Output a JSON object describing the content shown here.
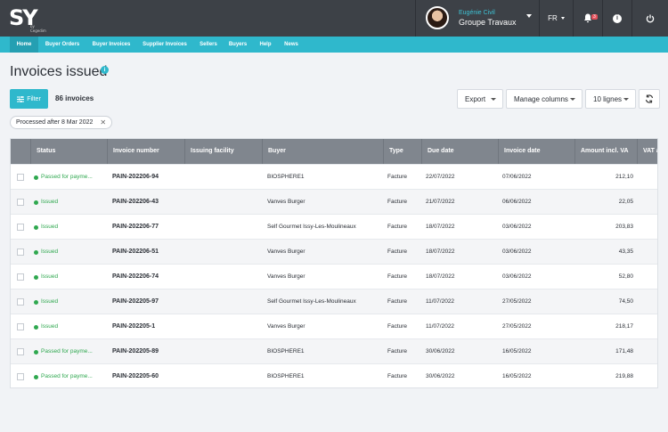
{
  "app": {
    "logo": "SY",
    "logo_sub": "by Cegedim"
  },
  "user": {
    "name": "Eugénie Civil",
    "company": "Groupe Travaux"
  },
  "header": {
    "language": "FR",
    "notifications_count": "3"
  },
  "nav": [
    "Home",
    "Buyer Orders",
    "Buyer Invoices",
    "Supplier Invoices",
    "Sellers",
    "Buyers",
    "Help",
    "News"
  ],
  "page": {
    "title": "Invoices issued",
    "filter_label": "Filter",
    "count": "86 invoices"
  },
  "toolbar": {
    "export": "Export",
    "manage_columns": "Manage columns",
    "rows": "10 lignes"
  },
  "filters": {
    "chip": "Processed after 8 Mar 2022"
  },
  "table": {
    "columns": [
      "Status",
      "Invoice number",
      "Issuing facility",
      "Buyer",
      "Type",
      "Due date",
      "Invoice date",
      "Amount incl. VA",
      "VAT a"
    ],
    "rows": [
      {
        "status": "Passed for payme...",
        "number": "PAIN-202206-94",
        "facility": "",
        "buyer": "BIOSPHERE1",
        "type": "Facture",
        "due": "22/07/2022",
        "date": "07/06/2022",
        "amount": "212,10"
      },
      {
        "status": "Issued",
        "number": "PAIN-202206-43",
        "facility": "",
        "buyer": "Vanves Burger",
        "type": "Facture",
        "due": "21/07/2022",
        "date": "06/06/2022",
        "amount": "22,05"
      },
      {
        "status": "Issued",
        "number": "PAIN-202206-77",
        "facility": "",
        "buyer": "Self Gourmet Issy-Les-Moulineaux",
        "type": "Facture",
        "due": "18/07/2022",
        "date": "03/06/2022",
        "amount": "203,83"
      },
      {
        "status": "Issued",
        "number": "PAIN-202206-51",
        "facility": "",
        "buyer": "Vanves Burger",
        "type": "Facture",
        "due": "18/07/2022",
        "date": "03/06/2022",
        "amount": "43,35"
      },
      {
        "status": "Issued",
        "number": "PAIN-202206-74",
        "facility": "",
        "buyer": "Vanves Burger",
        "type": "Facture",
        "due": "18/07/2022",
        "date": "03/06/2022",
        "amount": "52,80"
      },
      {
        "status": "Issued",
        "number": "PAIN-202205-97",
        "facility": "",
        "buyer": "Self Gourmet Issy-Les-Moulineaux",
        "type": "Facture",
        "due": "11/07/2022",
        "date": "27/05/2022",
        "amount": "74,50"
      },
      {
        "status": "Issued",
        "number": "PAIN-202205-1",
        "facility": "",
        "buyer": "Vanves Burger",
        "type": "Facture",
        "due": "11/07/2022",
        "date": "27/05/2022",
        "amount": "218,17"
      },
      {
        "status": "Passed for payme...",
        "number": "PAIN-202205-89",
        "facility": "",
        "buyer": "BIOSPHERE1",
        "type": "Facture",
        "due": "30/06/2022",
        "date": "16/05/2022",
        "amount": "171,48"
      },
      {
        "status": "Passed for payme...",
        "number": "PAIN-202205-60",
        "facility": "",
        "buyer": "BIOSPHERE1",
        "type": "Facture",
        "due": "30/06/2022",
        "date": "16/05/2022",
        "amount": "219,88"
      }
    ]
  },
  "colors": {
    "accent": "#2fb8cc",
    "topbar": "#3d4147",
    "status_green": "#2fa84f",
    "header_row": "#80868e"
  }
}
